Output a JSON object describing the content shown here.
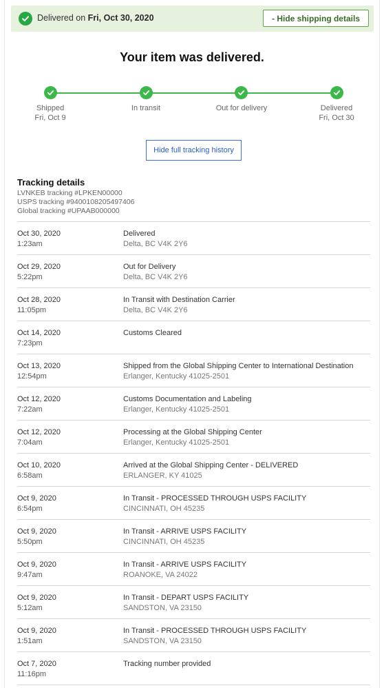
{
  "banner": {
    "prefix": "Delivered on ",
    "date": "Fri, Oct 30, 2020",
    "hide_button": "- Hide shipping details",
    "accent_color": "#28a745",
    "background_color": "#e6f1de"
  },
  "headline": "Your item was delivered.",
  "progress": {
    "color": "#3cb84a",
    "steps": [
      {
        "label": "Shipped",
        "sub": "Fri, Oct 9"
      },
      {
        "label": "In transit",
        "sub": ""
      },
      {
        "label": "Out for delivery",
        "sub": ""
      },
      {
        "label": "Delivered",
        "sub": "Fri, Oct 30"
      }
    ]
  },
  "history_button": "Hide full tracking history",
  "details": {
    "title": "Tracking details",
    "lines": [
      "LVNKEB tracking #LPKEN00000",
      "USPS tracking #9400108205497406",
      "Global tracking #UPAAB000000"
    ]
  },
  "events": [
    {
      "date": "Oct 30, 2020",
      "time": "1:23am",
      "status": "Delivered",
      "location": "Delta, BC V4K 2Y6"
    },
    {
      "date": "Oct 29, 2020",
      "time": "5:22pm",
      "status": "Out for Delivery",
      "location": "Delta, BC V4K 2Y6"
    },
    {
      "date": "Oct 28, 2020",
      "time": "11:05pm",
      "status": "In Transit with Destination Carrier",
      "location": "Delta, BC V4K 2Y6"
    },
    {
      "date": "Oct 14, 2020",
      "time": "7:23pm",
      "status": "Customs Cleared",
      "location": ""
    },
    {
      "date": "Oct 13, 2020",
      "time": "12:54pm",
      "status": "Shipped from the Global Shipping Center to International Destination",
      "location": "Erlanger, Kentucky 41025-2501"
    },
    {
      "date": "Oct 12, 2020",
      "time": "7:22am",
      "status": "Customs Documentation and Labeling",
      "location": "Erlanger, Kentucky 41025-2501"
    },
    {
      "date": "Oct 12, 2020",
      "time": "7:04am",
      "status": "Processing at the Global Shipping Center",
      "location": "Erlanger, Kentucky 41025-2501"
    },
    {
      "date": "Oct 10, 2020",
      "time": "6:58am",
      "status": "Arrived at the Global Shipping Center - DELIVERED",
      "location": "ERLANGER, KY 41025"
    },
    {
      "date": "Oct 9, 2020",
      "time": "6:54pm",
      "status": "In Transit - PROCESSED THROUGH USPS FACILITY",
      "location": "CINCINNATI, OH 45235"
    },
    {
      "date": "Oct 9, 2020",
      "time": "5:50pm",
      "status": "In Transit - ARRIVE USPS FACILITY",
      "location": "CINCINNATI, OH 45235"
    },
    {
      "date": "Oct 9, 2020",
      "time": "9:47am",
      "status": "In Transit - ARRIVE USPS FACILITY",
      "location": "ROANOKE, VA 24022"
    },
    {
      "date": "Oct 9, 2020",
      "time": "5:12am",
      "status": "In Transit - DEPART USPS FACILITY",
      "location": "SANDSTON, VA 23150"
    },
    {
      "date": "Oct 9, 2020",
      "time": "1:51am",
      "status": "In Transit - PROCESSED THROUGH USPS FACILITY",
      "location": "SANDSTON, VA 23150"
    },
    {
      "date": "Oct 7, 2020",
      "time": "11:16pm",
      "status": "Tracking number provided",
      "location": ""
    }
  ]
}
